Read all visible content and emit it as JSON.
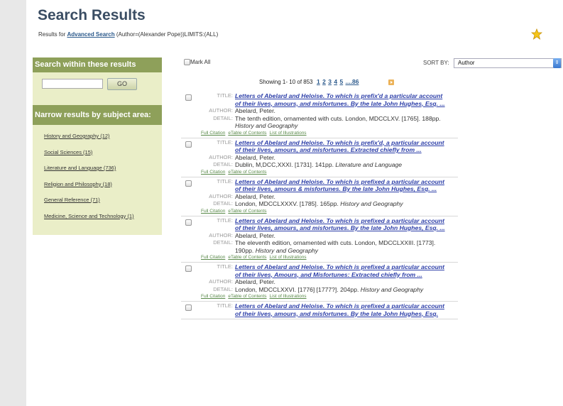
{
  "page": {
    "title": "Search Results",
    "results_for_prefix": "Results for ",
    "results_for_link": "Advanced Search",
    "results_for_suffix": " (Author=(Alexander Pope))LIMITS:(ALL)"
  },
  "sidebar": {
    "search_heading": "Search within these results",
    "search_value": "",
    "go_label": "GO",
    "narrow_heading": "Narrow results by subject area:",
    "subjects": [
      "History and Geography (12)",
      "Social Sciences (15)",
      "Literature and Language (736)",
      "Religion and Philosophy (18)",
      "General Reference (71)",
      "Medicine, Science and Technology (1)"
    ]
  },
  "toolbar": {
    "mark_all": "Mark All",
    "sort_by_label": "SORT BY:",
    "sort_value": "Author",
    "showing": "Showing 1- 10 of 853",
    "pages": [
      "1",
      "2",
      "3",
      "4",
      "5",
      "....86"
    ]
  },
  "labels": {
    "title": "TITLE:",
    "author": "AUTHOR:",
    "detail": "DETAIL:"
  },
  "records": [
    {
      "title": "Letters of Abelard and Heloise. To which is prefix'd a particular account of their lives, amours, and misfortunes. By the late John Hughes, Esq. ...",
      "author": "Abelard, Peter.",
      "detail": "The tenth edition, ornamented with cuts. London, MDCCLXV. [1765]. 188pp.",
      "subject": "History and Geography",
      "links": [
        "Full Citation",
        "eTable of Contents",
        "List of Illustrations"
      ]
    },
    {
      "title": "Letters of Abelard and Heloise. To which is prefix'd, a particular account of their lives, amours, and misfortunes. Extracted chiefly from ...",
      "author": "Abelard, Peter.",
      "detail": "Dublin, M,DCC,XXXI. [1731]. 141pp.",
      "subject": "Literature and Language",
      "links": [
        "Full Citation",
        "eTable of Contents"
      ]
    },
    {
      "title": "Letters of Abelard and Heloise. To which is prefixed a particular account of their lives, amours & misfortunes. By the late John Hughes, Esq. ...",
      "author": "Abelard, Peter.",
      "detail": "London, MDCCLXXXV. [1785]. 165pp.",
      "subject": "History and Geography",
      "links": [
        "Full Citation",
        "eTable of Contents"
      ]
    },
    {
      "title": "Letters of Abelard and Heloise. To which is prefixed a particular account of their lives, amours, and misfortunes. By the late John Hughes, Esq. ...",
      "author": "Abelard, Peter.",
      "detail": "The eleventh edition, ornamented with cuts. London, MDCCLXXIII. [1773]. 190pp.",
      "subject": "History and Geography",
      "links": [
        "Full Citation",
        "eTable of Contents",
        "List of Illustrations"
      ]
    },
    {
      "title": "Letters of Abelard and Heloise. To which is prefixed a particular account of their lives, Amours, and Misfortunes: Extracted chiefly from ...",
      "author": "Abelard, Peter.",
      "detail": "London, MDCCLXXVI. [1776] [1777?]. 204pp.",
      "subject": "History and Geography",
      "links": [
        "Full Citation",
        "eTable of Contents",
        "List of Illustrations"
      ]
    },
    {
      "title": "Letters of Abelard and Heloise. To which is prefixed a particular account of their lives, amours, and misfortunes. By the late John Hughes, Esq.",
      "author": "",
      "detail": "",
      "subject": "",
      "links": []
    }
  ],
  "colors": {
    "sidebar_header": "#8ea05a",
    "sidebar_bg": "#eaeec8",
    "title_link": "#2c3ea8",
    "heading": "#3a4d63"
  }
}
